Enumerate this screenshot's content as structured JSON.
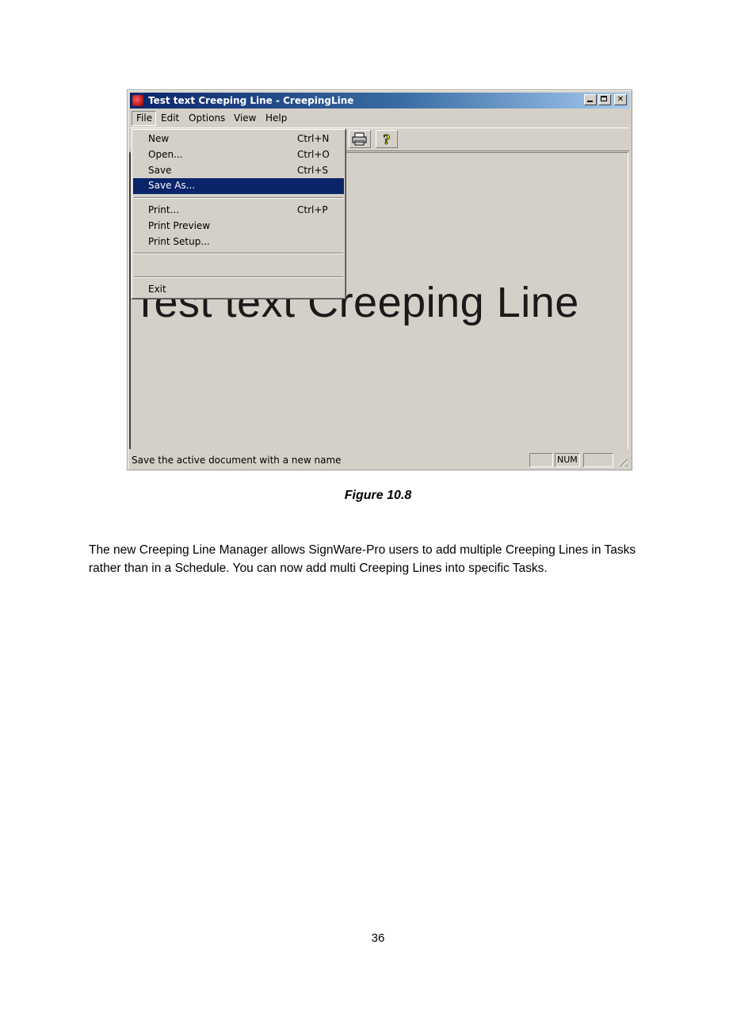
{
  "window": {
    "title": "Test text Creeping Line - CreepingLine",
    "menubar": [
      "File",
      "Edit",
      "Options",
      "View",
      "Help"
    ],
    "canvas_text": "Test text Creeping Line",
    "status_text": "Save the active document with a new name",
    "status_panes": [
      "",
      "NUM",
      ""
    ]
  },
  "file_menu": {
    "items": [
      {
        "label": "New",
        "shortcut": "Ctrl+N"
      },
      {
        "label": "Open...",
        "shortcut": "Ctrl+O"
      },
      {
        "label": "Save",
        "shortcut": "Ctrl+S"
      },
      {
        "label": "Save As...",
        "shortcut": ""
      },
      {
        "label": "Print...",
        "shortcut": "Ctrl+P"
      },
      {
        "label": "Print Preview",
        "shortcut": ""
      },
      {
        "label": "Print Setup...",
        "shortcut": ""
      },
      {
        "label": "Exit",
        "shortcut": ""
      }
    ],
    "selected": "Save As..."
  },
  "document": {
    "caption": "Figure 10.8",
    "paragraph_lines": [
      "The new Creeping Line Manager allows SignWare-Pro users to add multiple Creeping Lines in Tasks",
      "rather than in a Schedule. You can now add multi Creeping Lines into specific Tasks."
    ],
    "page_number": "36"
  }
}
